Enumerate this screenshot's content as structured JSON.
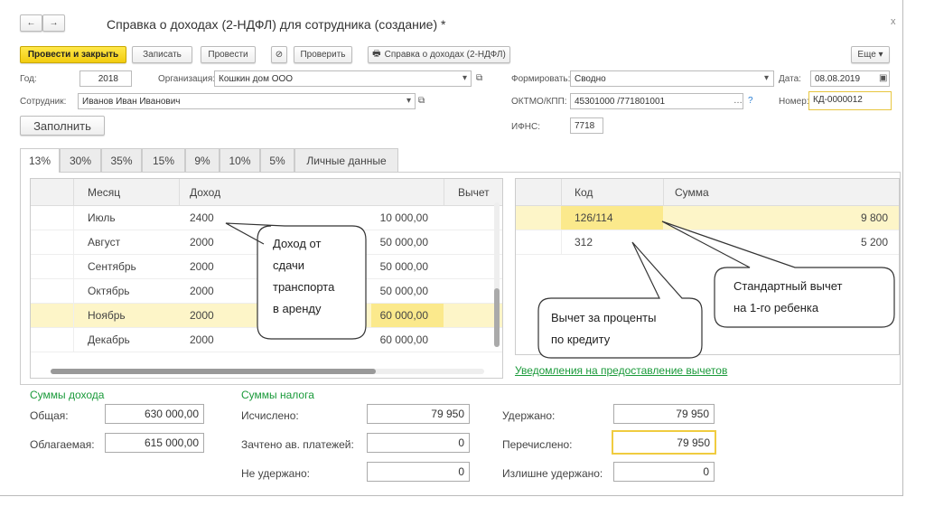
{
  "window": {
    "title": "Справка о доходах (2-НДФЛ) для сотрудника (создание) *",
    "close": "x",
    "back": "←",
    "forward": "→"
  },
  "toolbar": {
    "post_close": "Провести и закрыть",
    "save": "Записать",
    "post": "Провести",
    "check": "Проверить",
    "print": "Справка о доходах (2-НДФЛ)",
    "more": "Еще ▾"
  },
  "form": {
    "year_label": "Год:",
    "year": "2018",
    "org_label": "Организация:",
    "org": "Кошкин дом ООО",
    "form_label": "Формировать:",
    "form_value": "Сводно",
    "date_label": "Дата:",
    "date": "08.08.2019",
    "employee_label": "Сотрудник:",
    "employee": "Иванов Иван Иванович",
    "oktmo_label": "ОКТМО/КПП:",
    "oktmo": "45301000   /771801001",
    "help": "?",
    "number_label": "Номер:",
    "number": "КД-0000012",
    "ifns_label": "ИФНС:",
    "ifns": "7718",
    "fill": "Заполнить"
  },
  "tabs": [
    "13%",
    "30%",
    "35%",
    "15%",
    "9%",
    "10%",
    "5%",
    "Личные данные"
  ],
  "income_table": {
    "headers": [
      "Месяц",
      "Доход",
      "Вычет"
    ],
    "rows": [
      [
        "Июль",
        "2400",
        "10 000,00"
      ],
      [
        "Август",
        "2000",
        "50 000,00"
      ],
      [
        "Сентябрь",
        "2000",
        "50 000,00"
      ],
      [
        "Октябрь",
        "2000",
        "50 000,00"
      ],
      [
        "Ноябрь",
        "2000",
        "60 000,00"
      ],
      [
        "Декабрь",
        "2000",
        "60 000,00"
      ]
    ],
    "selected_row": 4
  },
  "deduction_table": {
    "headers": [
      "Код",
      "Сумма"
    ],
    "rows": [
      [
        "126/114",
        "9 800"
      ],
      [
        "312",
        "5 200"
      ]
    ],
    "selected_row": 0
  },
  "notifications_link": "Уведомления на предоставление вычетов",
  "callouts": {
    "income": [
      "Доход от",
      "сдачи",
      "транспорта",
      "в аренду"
    ],
    "interest": [
      "Вычет за проценты",
      "по кредиту"
    ],
    "standard": [
      "Стандартный вычет",
      "на 1-го ребенка"
    ]
  },
  "totals": {
    "income_title": "Суммы дохода",
    "total_label": "Общая:",
    "total": "630 000,00",
    "taxable_label": "Облагаемая:",
    "taxable": "615 000,00",
    "tax_title": "Суммы налога",
    "calc_label": "Исчислено:",
    "calc": "79 950",
    "advance_label": "Зачтено ав. платежей:",
    "advance": "0",
    "not_withheld_label": "Не удержано:",
    "not_withheld": "0",
    "withheld_label": "Удержано:",
    "withheld": "79 950",
    "transferred_label": "Перечислено:",
    "transferred": "79 950",
    "excess_label": "Излишне удержано:",
    "excess": "0"
  },
  "colors": {
    "accent": "#f2cc0f",
    "selection": "#fdf5c8",
    "link": "#1a9a3a"
  }
}
